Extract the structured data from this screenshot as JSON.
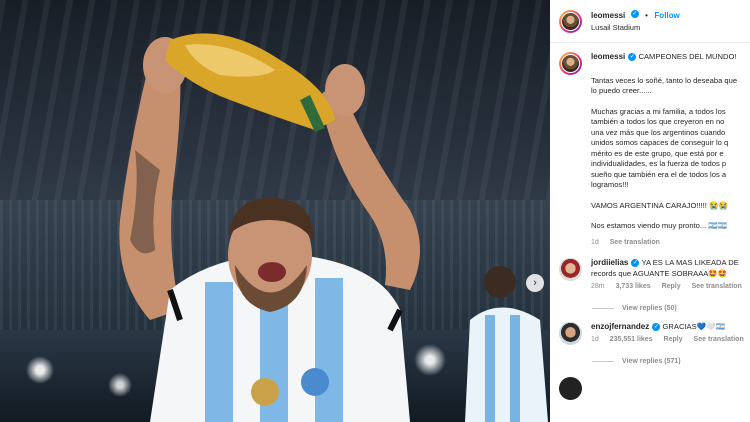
{
  "post": {
    "username": "leomessi",
    "follow_label": "Follow",
    "location": "Lusail Stadium",
    "caption_title": "CAMPEONES DEL MUNDO!",
    "caption_lines": [
      "Tantas veces lo soñé, tanto lo deseaba que",
      "lo puedo creer......",
      "Muchas gracias a mi familia, a todos los",
      "también a todos los que creyeron en no",
      "una vez más que los argentinos cuando",
      "unidos somos capaces de conseguir lo q",
      "mérito es de este grupo, que está por e",
      "individualidades, es la fuerza de todos p",
      "sueño que también era el de todos los a",
      "logramos!!!",
      "VAMOS ARGENTINA CARAJO!!!!! 😭😭",
      "Nos estamos viendo muy pronto... 🇦🇷🇦🇷"
    ],
    "caption_time": "1d",
    "caption_translate": "See translation"
  },
  "comments": [
    {
      "username": "jordiielias",
      "text": "YA ES LA MAS LIKEADA DE",
      "text2": "records que AGUANTE SOBRAAA🤩🤩",
      "time": "28m",
      "likes": "3,733 likes",
      "reply": "Reply",
      "translate": "See translation",
      "view_replies": "View replies (50)"
    },
    {
      "username": "enzojfernandez",
      "text": "GRACIAS💙🤍🇦🇷",
      "time": "1d",
      "likes": "235,551 likes",
      "reply": "Reply",
      "translate": "See translation",
      "view_replies": "View replies (571)"
    }
  ],
  "icons": {
    "verified": "verified-badge-icon",
    "next": "chevron-right-icon",
    "heart": "heart-icon"
  },
  "colors": {
    "link": "#0095f6",
    "muted": "#8e8e8e"
  }
}
